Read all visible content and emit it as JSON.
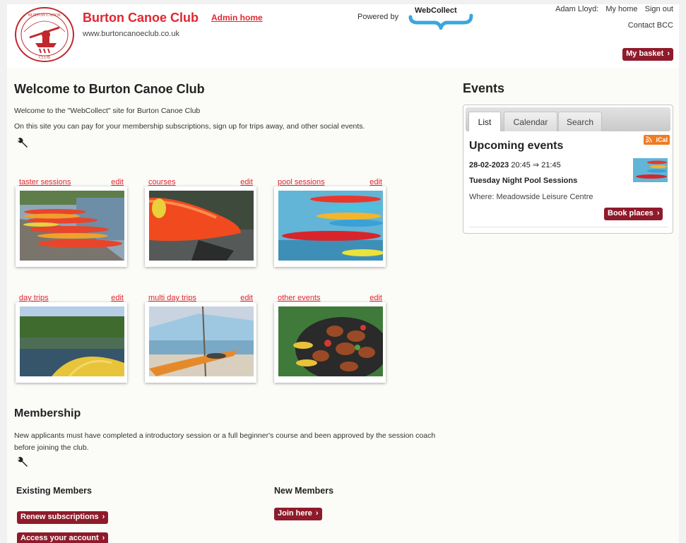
{
  "header": {
    "site_title": "Burton Canoe Club",
    "admin_link": "Admin home",
    "site_url": "www.burtoncanoeclub.co.uk",
    "powered_by": "Powered by",
    "webcollect_logo_text": "WebCollect",
    "user_name": "Adam Lloyd:",
    "my_home": "My home",
    "sign_out": "Sign out",
    "contact": "Contact BCC",
    "basket": "My basket",
    "logo_text": "BURTON CANOE CLUB"
  },
  "welcome": {
    "title": "Welcome to Burton Canoe Club",
    "para1": "Welcome to the \"WebCollect\" site for Burton Canoe Club",
    "para2": "On this site you can pay for your membership subscriptions, sign up for trips away, and other social events."
  },
  "tiles": [
    {
      "label": "taster sessions",
      "edit": "edit",
      "image": "kayaks-on-shore"
    },
    {
      "label": "courses",
      "edit": "edit",
      "image": "red-kayak-closeup"
    },
    {
      "label": "pool sessions",
      "edit": "edit",
      "image": "kayaks-poolside"
    },
    {
      "label": "day trips",
      "edit": "edit",
      "image": "river-kayak-bow"
    },
    {
      "label": "multi day trips",
      "edit": "edit",
      "image": "kayak-beach-shelter"
    },
    {
      "label": "other events",
      "edit": "edit",
      "image": "barbecue-grill"
    }
  ],
  "membership": {
    "title": "Membership",
    "text": "New applicants must have completed a introductory session or a full beginner's course and been approved by the session coach before joining the club.",
    "existing_title": "Existing Members",
    "renew": "Renew subscriptions",
    "access": "Access your account",
    "new_title": "New Members",
    "join": "Join here"
  },
  "events": {
    "title": "Events",
    "tabs": [
      "List",
      "Calendar",
      "Search"
    ],
    "active_tab": "List",
    "ical": "iCal",
    "upcoming_title": "Upcoming events",
    "event_date": "28-02-2023",
    "event_time": "20:45 ⇒ 21:45",
    "event_name": "Tuesday Night Pool Sessions",
    "event_where": "Where: Meadowside Leisure Centre",
    "book": "Book places"
  },
  "colors": {
    "link_red": "#e2262f",
    "button_maroon": "#8e1b2b",
    "ical_orange": "#f07b22"
  },
  "icons": [
    "wrench-icon",
    "chevron-right-icon",
    "rss-icon",
    "club-logo",
    "webcollect-logo"
  ]
}
